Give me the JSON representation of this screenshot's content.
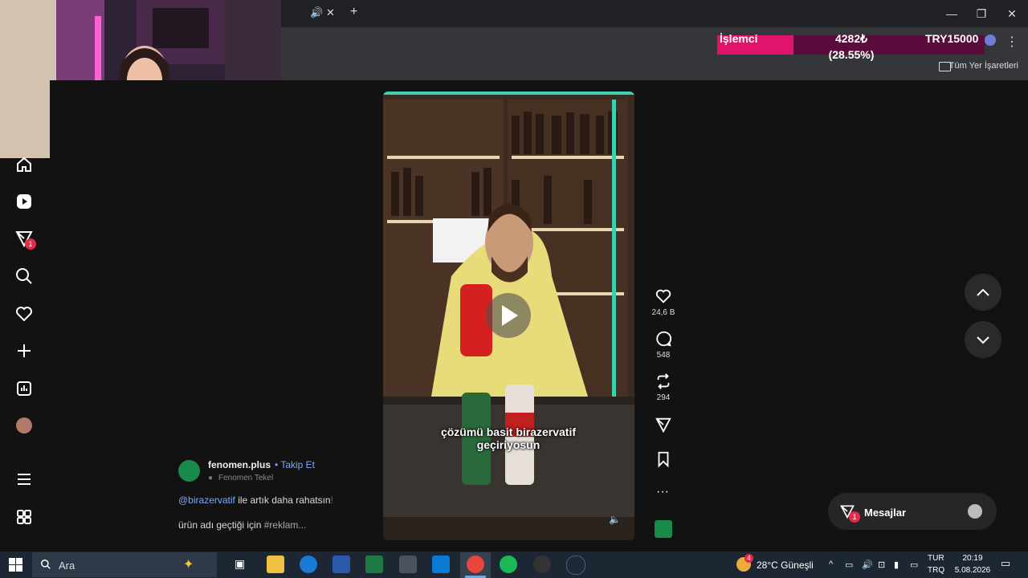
{
  "browser": {
    "bookmarks_folder": "Tüm Yer İşaretleri"
  },
  "donation_widget": {
    "label": "İşlemci",
    "amount": "4282₺",
    "percent_text": "(28.55%)",
    "goal": "TRY15000",
    "progress": 0.2855
  },
  "post": {
    "author": "fenomen.plus",
    "follow_label": "• Takip Et",
    "location": "Fenomen Tekel",
    "mention": "@birazervatif",
    "desc_line1_rest": " ile artık daha rahatsın",
    "desc_line1_mark": "!",
    "desc_line2": "ürün adı geçtiği için ",
    "desc_line2_tag": "#reklam...",
    "caption_line1": "çözümü basit birazervatif",
    "caption_line2": "geçiriyosun"
  },
  "actions": {
    "likes": "24,6 B",
    "comments": "548",
    "reposts": "294"
  },
  "messages": {
    "label": "Mesajlar",
    "badge": "1"
  },
  "sidebar": {
    "notifications_badge": "1"
  },
  "taskbar": {
    "search_placeholder": "Ara",
    "weather": "28°C  Güneşli",
    "weather_badge": "4",
    "lang_top": "TUR",
    "lang_bottom": "TRQ",
    "time": "20:19",
    "date": "5.08.2026"
  },
  "colors": {
    "progress_fill": "#e0146a",
    "progress_bg": "#5a0c3c",
    "link": "#7aa7ff",
    "badge": "#e8294a"
  }
}
